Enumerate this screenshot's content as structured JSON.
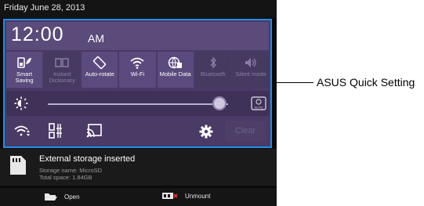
{
  "status_bar": {
    "date": "Friday June 28, 2013"
  },
  "quick_settings": {
    "time": "12:00",
    "ampm": "AM",
    "tiles": [
      {
        "label": "Smart\nSaving",
        "icon": "smart-saving-icon",
        "state": "on"
      },
      {
        "label": "Instant\nDictionary",
        "icon": "dictionary-icon",
        "state": "off"
      },
      {
        "label": "Auto-rotate",
        "icon": "auto-rotate-icon",
        "state": "on"
      },
      {
        "label": "Wi-Fi",
        "icon": "wifi-icon",
        "state": "on"
      },
      {
        "label": "Mobile Data",
        "icon": "mobile-data-icon",
        "state": "on"
      },
      {
        "label": "Bluetooth",
        "icon": "bluetooth-icon",
        "state": "off"
      },
      {
        "label": "Silent mode",
        "icon": "silent-mode-icon",
        "state": "off"
      }
    ],
    "brightness": {
      "level": 0.95,
      "auto_label": "AUTO"
    },
    "clear_label": "Clear"
  },
  "notification": {
    "title": "External storage inserted",
    "line1": "Storage name: MicroSD",
    "line2": "Total space: 1.84GB",
    "actions": {
      "open": "Open",
      "unmount": "Unmount"
    }
  },
  "callout": {
    "label": "ASUS Quick Setting"
  },
  "colors": {
    "highlight": "#1f8fe6",
    "panel": "#4a3a66"
  }
}
